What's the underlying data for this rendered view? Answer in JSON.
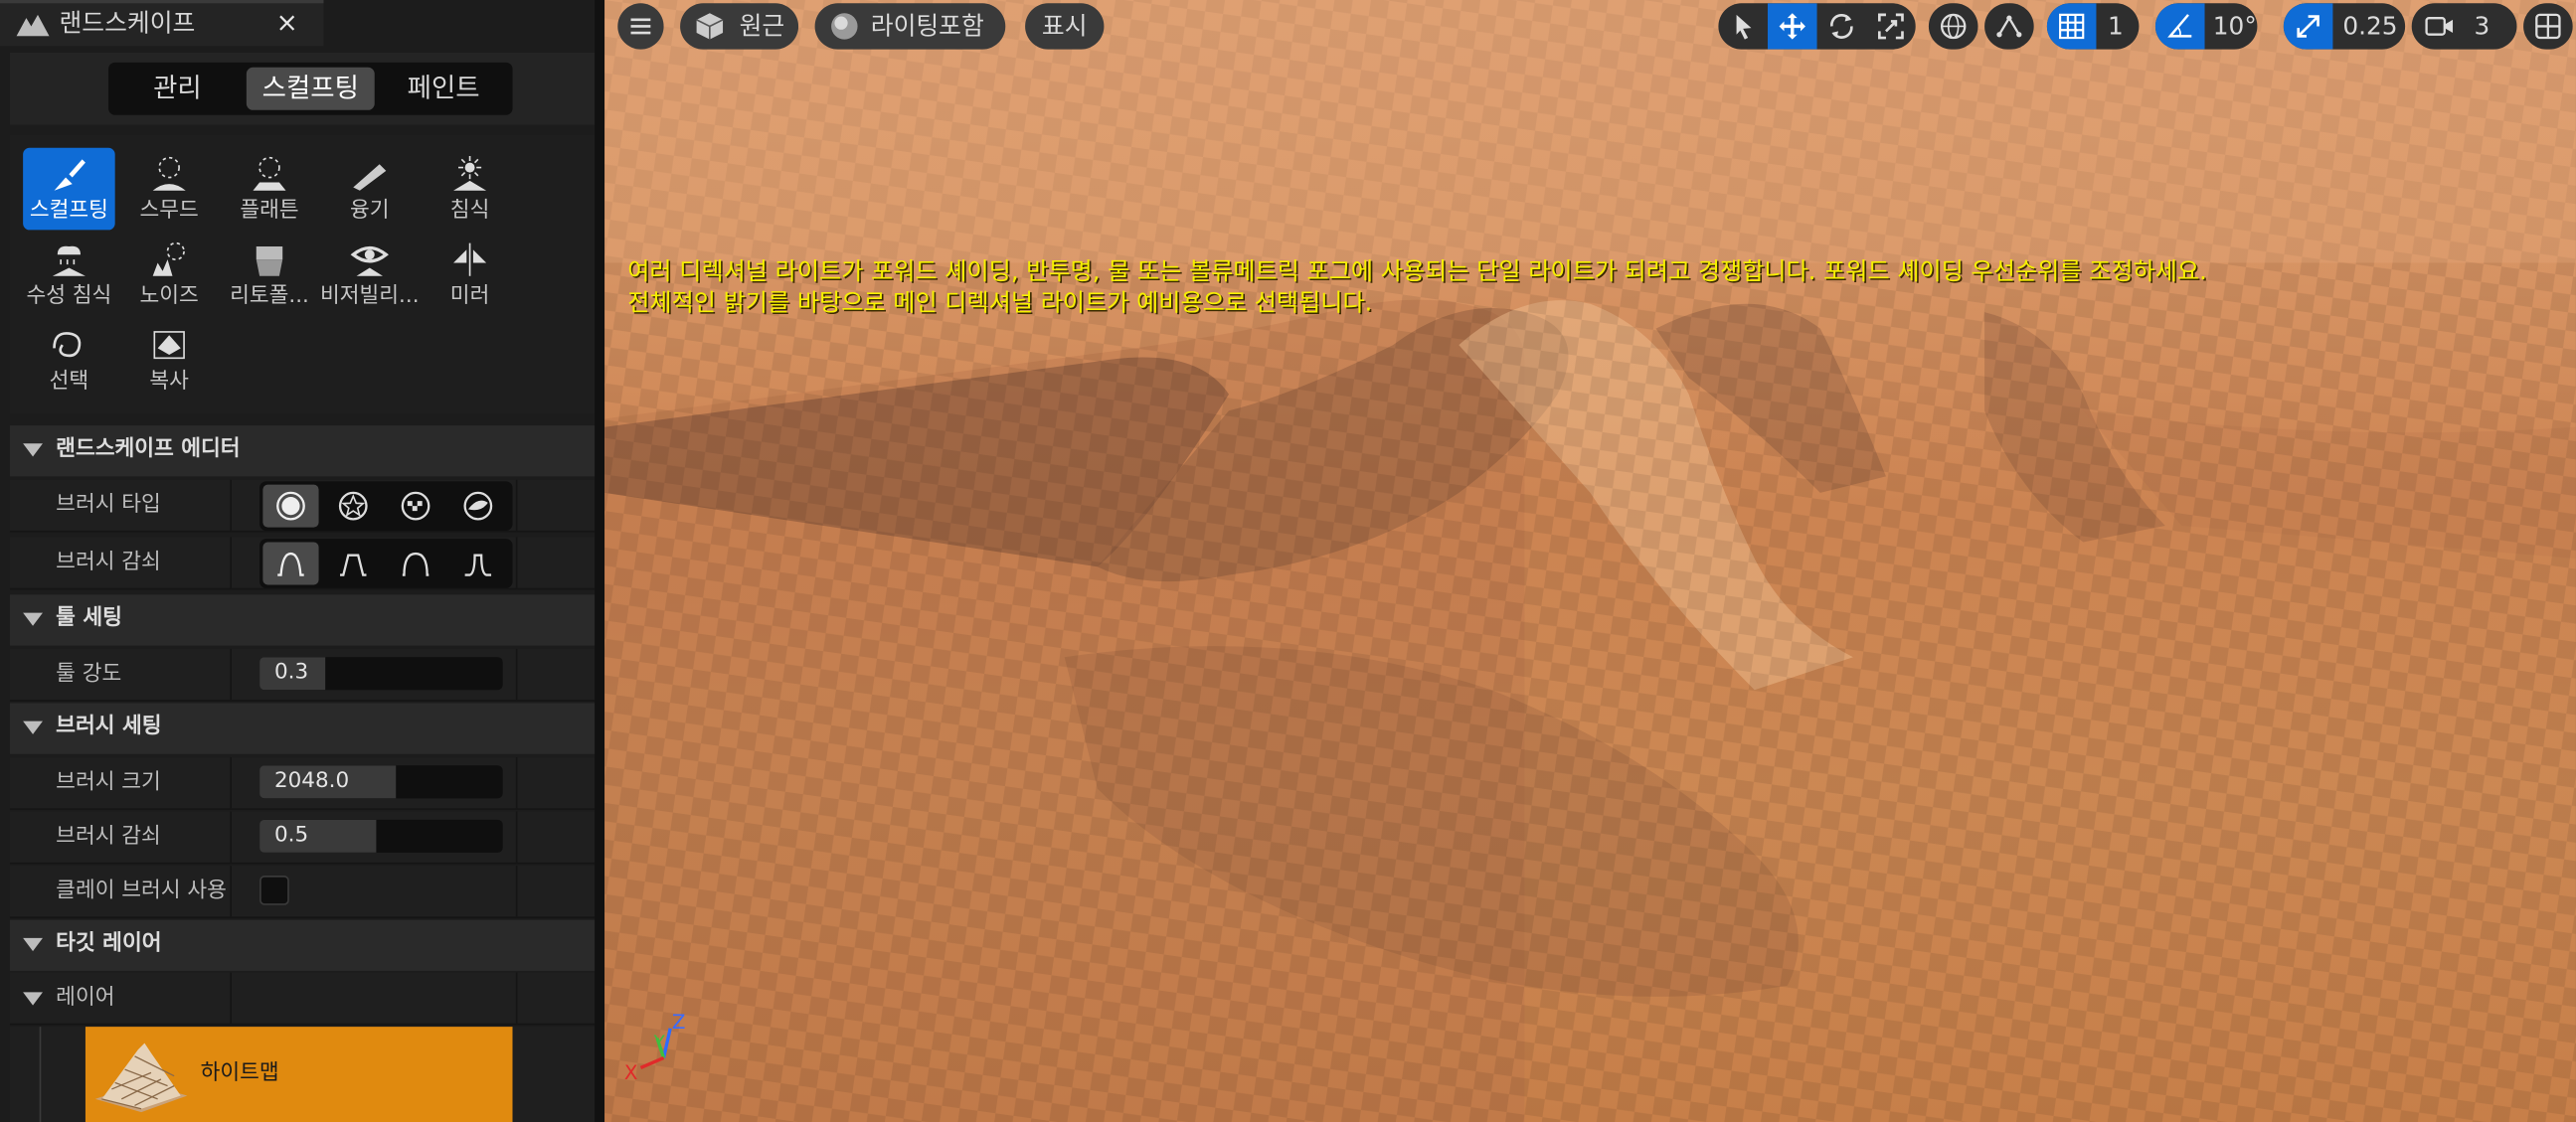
{
  "panel": {
    "tab_title": "랜드스케이프",
    "close_glyph": "×",
    "modes": [
      "관리",
      "스컬프팅",
      "페인트"
    ],
    "active_mode": "스컬프팅",
    "tools": [
      {
        "label": "스컬프팅",
        "icon": "sculpt-brush-icon",
        "active": true
      },
      {
        "label": "스무드",
        "icon": "smooth-icon"
      },
      {
        "label": "플래튼",
        "icon": "flatten-icon"
      },
      {
        "label": "융기",
        "icon": "ramp-icon"
      },
      {
        "label": "침식",
        "icon": "erosion-icon"
      },
      {
        "label": "수성 침식",
        "icon": "hydro-erosion-icon"
      },
      {
        "label": "노이즈",
        "icon": "noise-icon"
      },
      {
        "label": "리토폴...",
        "icon": "retopologize-icon"
      },
      {
        "label": "비저빌리...",
        "icon": "visibility-icon"
      },
      {
        "label": "미러",
        "icon": "mirror-icon"
      },
      {
        "label": "선택",
        "icon": "select-icon"
      },
      {
        "label": "복사",
        "icon": "copy-icon"
      }
    ],
    "sections": {
      "landscape_editor": "랜드스케이프 에디터",
      "tool_settings": "툴 세팅",
      "brush_settings": "브러시 세팅",
      "target_layers": "타깃 레이어"
    },
    "brush_type": {
      "label": "브러시 타입",
      "options": [
        "circle-brush-icon",
        "alpha-brush-icon",
        "pattern-brush-icon",
        "component-brush-icon"
      ],
      "selected": 0
    },
    "brush_falloff": {
      "label": "브러시 감쇠",
      "options": [
        "smooth-falloff-icon",
        "linear-falloff-icon",
        "spherical-falloff-icon",
        "tip-falloff-icon"
      ],
      "selected": 0
    },
    "tool_strength": {
      "label": "툴 강도",
      "value": "0.3",
      "fraction": 0.27
    },
    "brush_size": {
      "label": "브러시 크기",
      "value": "2048.0",
      "fraction": 0.56
    },
    "brush_falloff_value": {
      "label": "브러시 감쇠",
      "value": "0.5",
      "fraction": 0.48
    },
    "clay_brush": {
      "label": "클레이 브러시 사용",
      "checked": false
    },
    "layers_label": "레이어",
    "layer_item": {
      "name": "하이트맵",
      "icon": "heightmap-thumbnail"
    }
  },
  "viewport": {
    "menu_icon": "hamburger-icon",
    "perspective": "원근",
    "view_mode": "라이팅포함",
    "show": "표시",
    "grid_snap": "1",
    "rotation_snap": "10°",
    "scale_snap": "0.25",
    "camera_speed": "3",
    "warning_lines": [
      "여러 디렉셔널 라이트가 포워드 셰이딩, 반투명, 물 또는 볼류메트릭 포그에 사용되는 단일 라이트가 되려고 경쟁합니다. 포워드 셰이딩 우선순위를 조정하세요.",
      "전체적인 밝기를 바탕으로 메인 디렉셔널 라이트가 예비용으로 선택됩니다."
    ],
    "axis_labels": {
      "x": "X",
      "y": "Y",
      "z": "Z"
    }
  },
  "colors": {
    "accent": "#0f6cd6",
    "layer_highlight": "#e08a0f",
    "warning_text": "#f6f000",
    "sand": "#c9844f"
  }
}
